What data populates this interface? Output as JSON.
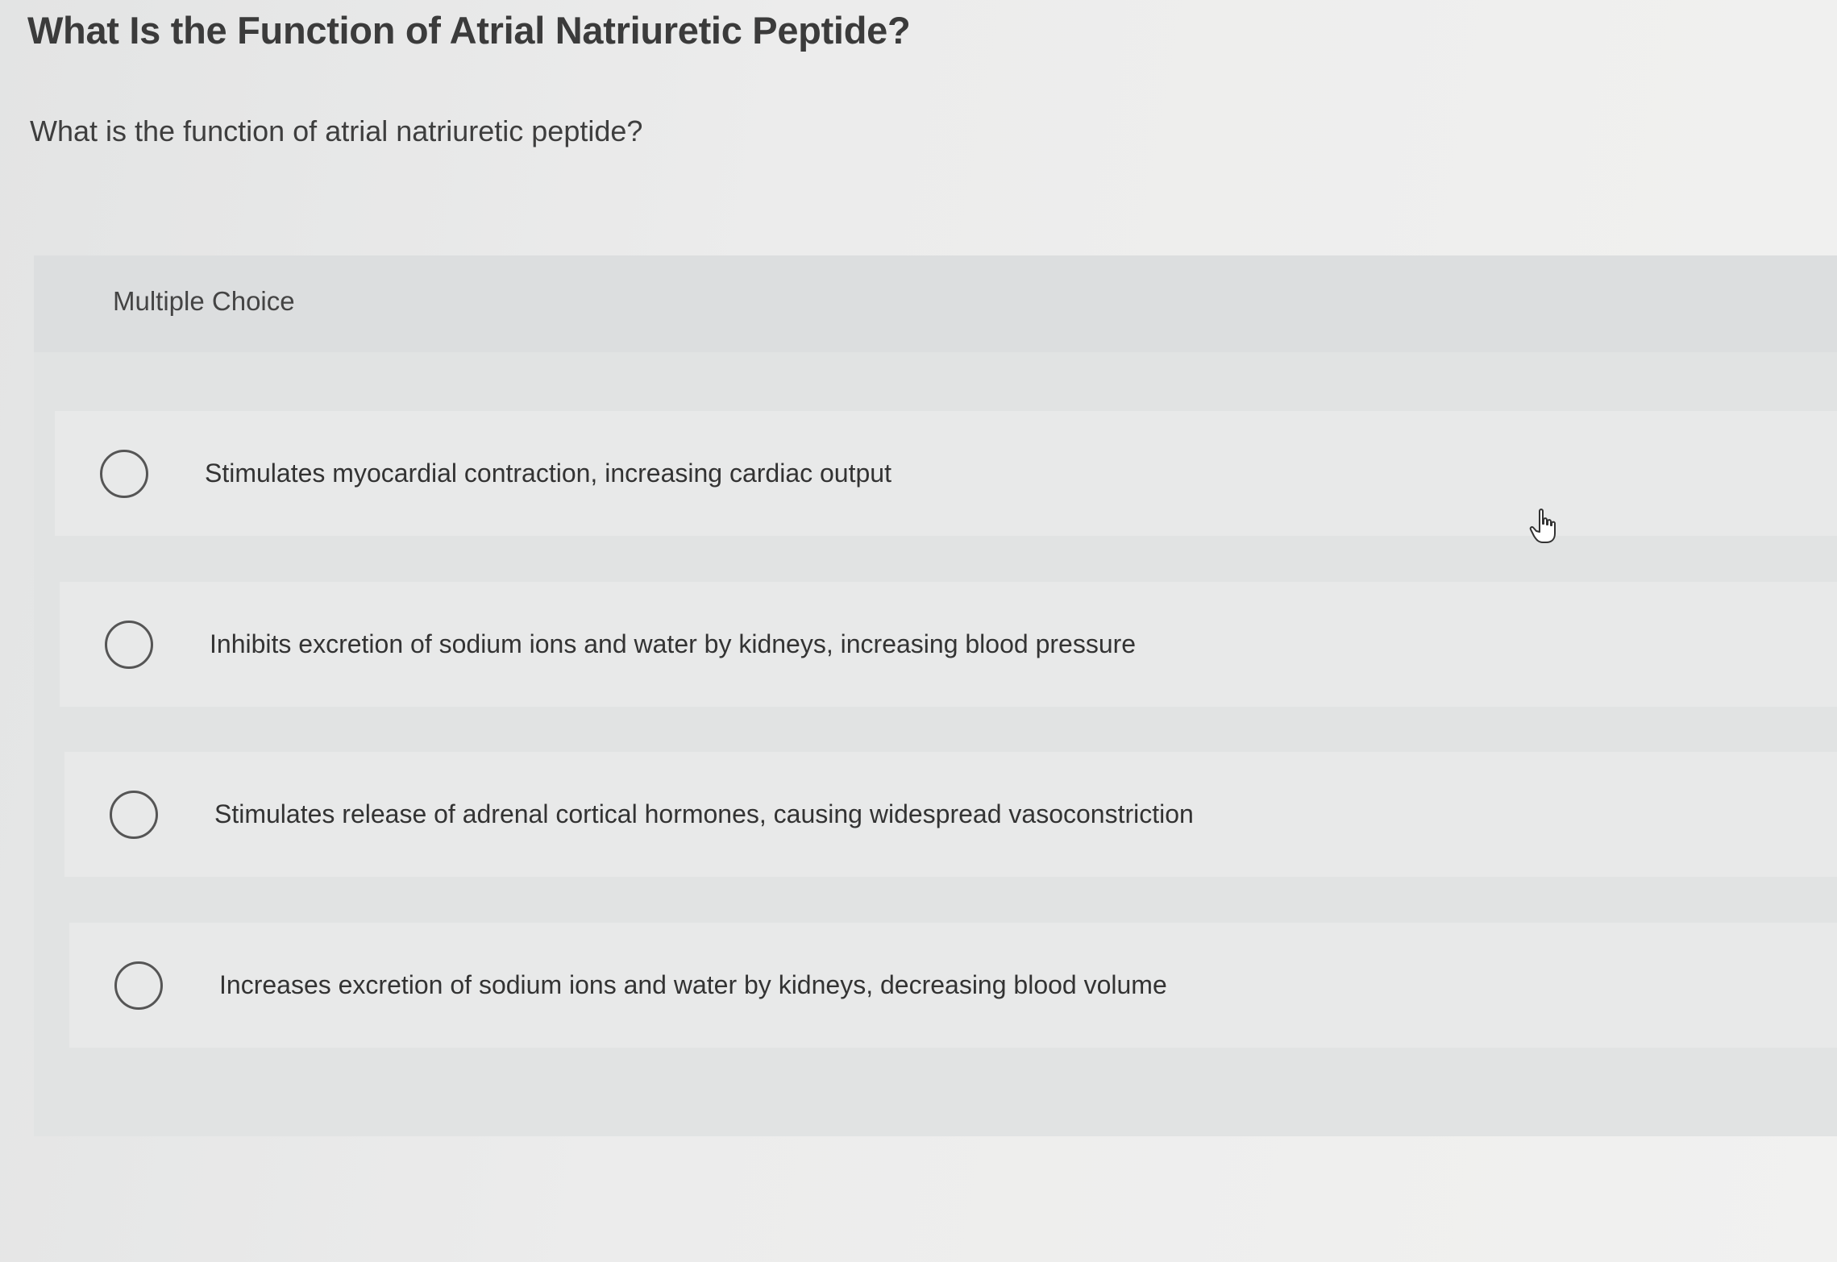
{
  "page": {
    "title": "What Is the Function of Atrial Natriuretic Peptide?",
    "question": "What is the function of atrial natriuretic peptide?"
  },
  "multiple_choice": {
    "header": "Multiple Choice",
    "options": [
      {
        "label": "Stimulates myocardial contraction, increasing cardiac output",
        "selected": false
      },
      {
        "label": "Inhibits excretion of sodium ions and water by kidneys, increasing blood pressure",
        "selected": false
      },
      {
        "label": "Stimulates release of adrenal cortical hormones, causing widespread vasoconstriction",
        "selected": false
      },
      {
        "label": "Increases excretion of sodium ions and water by kidneys, decreasing blood volume",
        "selected": false
      }
    ]
  },
  "icons": {
    "radio": "radio-unselected-icon",
    "cursor": "hand-pointer-icon"
  },
  "colors": {
    "background": "#e9eaea",
    "panel": "#e1e3e3",
    "option_row": "#e8e9e9",
    "text": "#3a3a3a"
  }
}
